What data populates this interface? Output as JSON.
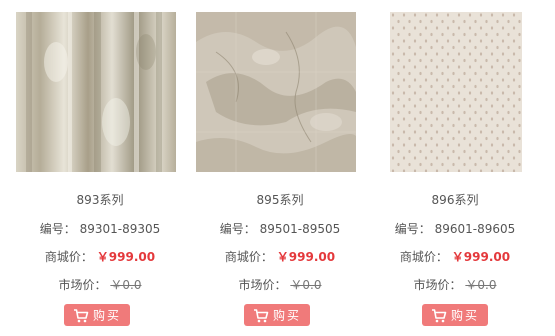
{
  "products": [
    {
      "series": "893系列",
      "code_label": "编号：",
      "code": "89301-89305",
      "mall_label": "商城价：",
      "mall_price": "￥999.00",
      "market_label": "市场价：",
      "market_price": "￥0.0",
      "buy_label": "购买",
      "image_icon": "birch-wallpaper-swatch"
    },
    {
      "series": "895系列",
      "code_label": "编号：",
      "code": "89501-89505",
      "mall_label": "商城价：",
      "mall_price": "￥999.00",
      "market_label": "市场价：",
      "market_price": "￥0.0",
      "buy_label": "购买",
      "image_icon": "map-wallpaper-swatch"
    },
    {
      "series": "896系列",
      "code_label": "编号：",
      "code": "89601-89605",
      "mall_label": "商城价：",
      "mall_price": "￥999.00",
      "market_label": "市场价：",
      "market_price": "￥0.0",
      "buy_label": "购买",
      "image_icon": "dotted-wallpaper-swatch"
    }
  ],
  "colors": {
    "price_red": "#e4393c",
    "buy_button": "#f07a7a"
  }
}
